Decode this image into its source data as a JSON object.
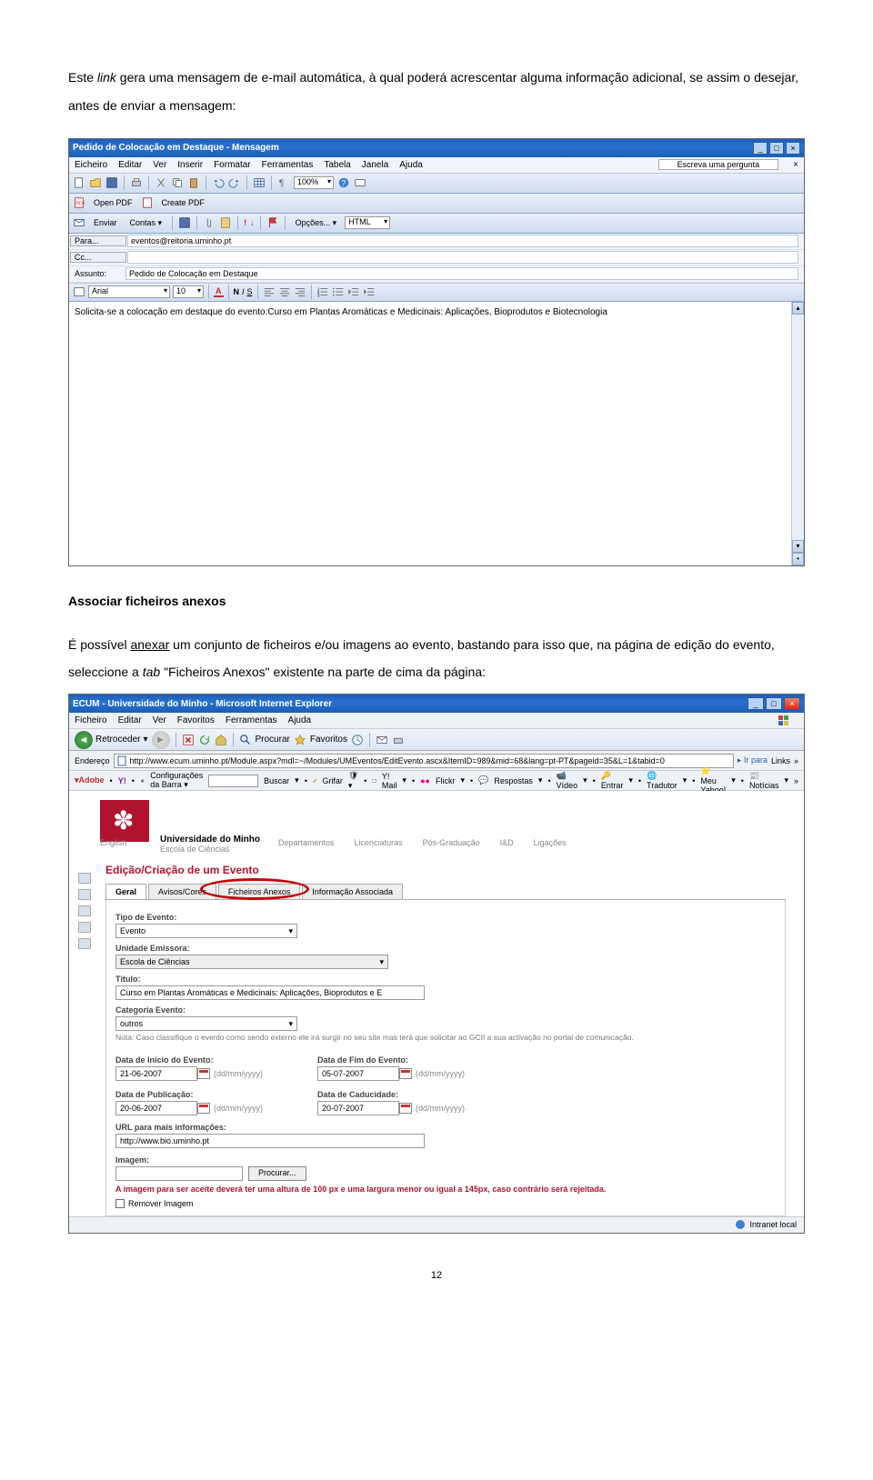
{
  "intro_prefix": "Este ",
  "intro_link": "link",
  "intro_rest": " gera uma mensagem de e-mail automática, à qual poderá acrescentar alguma informação adicional, se assim o desejar, antes de enviar a mensagem:",
  "section_title": "Associar ficheiros anexos",
  "para_prefix": "É possível ",
  "para_anexar": "anexar",
  "para_mid": " um conjunto de ficheiros e/ou imagens ao evento, bastando para isso que, na página de edição do evento, seleccione a ",
  "para_tab": "tab",
  "para_end": " \"Ficheiros Anexos\" existente na parte de cima da página:",
  "page_number": "12",
  "outlook": {
    "title": "Pedido de Colocação em Destaque - Mensagem",
    "menu": [
      "Eicheiro",
      "Editar",
      "Ver",
      "Inserir",
      "Formatar",
      "Ferramentas",
      "Tabela",
      "Janela",
      "Ajuda"
    ],
    "pergunta": "Escreva uma pergunta",
    "pdf1": "Open PDF",
    "pdf2": "Create PDF",
    "enviar": "Enviar",
    "contas": "Contas ▾",
    "opcoes": "Opções... ▾",
    "html": "HTML",
    "zoom": "100%",
    "para_label": "Para...",
    "para_value": "eventos@reitoria.uminho.pt",
    "cc_label": "Cc...",
    "assunto_label": "Assunto:",
    "assunto_value": "Pedido de Colocação em Destaque",
    "font": "Arial",
    "size": "10",
    "body": "Solicita-se a colocação em destaque do evento:Curso em Plantas Aromáticas e Medicinais: Aplicações, Bioprodutos e Biotecnologia"
  },
  "ie": {
    "title": "ECUM - Universidade do Minho - Microsoft Internet Explorer",
    "menu": [
      "Ficheiro",
      "Editar",
      "Ver",
      "Favoritos",
      "Ferramentas",
      "Ajuda"
    ],
    "retroceder": "Retroceder",
    "procurar": "Procurar",
    "favoritos": "Favoritos",
    "endereco_label": "Endereço",
    "endereco_value": "http://www.ecum.uminho.pt/Module.aspx?mdl=~/Modules/UMEventos/EditEvento.ascx&ItemID=989&mid=68&lang=pt-PT&pageid=35&L=1&tabid=0",
    "ir_para": "Ir para",
    "links": "Links",
    "adobe": "Adobe",
    "yahoo": "Y!",
    "config": "Configurações da Barra ▾",
    "buscar": "Buscar",
    "grifar": "Grifar",
    "ymail": "Y! Mail",
    "flickr": "Flickr",
    "respostas": "Respostas",
    "video": "Vídeo",
    "entrar": "Entrar",
    "tradutor": "Tradutor",
    "meuyahoo": "Meu Yahoo!",
    "noticias": "Notícias",
    "english": "English",
    "univ": "Universidade do Minho",
    "escola": "Escola de Ciências",
    "topnav": [
      "Departamentos",
      "Licenciaturas",
      "Pós-Graduação",
      "I&D",
      "Ligações"
    ],
    "page_title": "Edição/Criação de um Evento",
    "tabs": [
      "Geral",
      "Avisos/Cores",
      "Ficheiros Anexos",
      "Informação Associada"
    ],
    "tipo_label": "Tipo de Evento:",
    "tipo_value": "Evento",
    "unidade_label": "Unidade Emissora:",
    "unidade_value": "Escola de Ciências",
    "titulo_label": "Título:",
    "titulo_value": "Curso em Plantas Aromáticas e Medicinais: Aplicações, Bioprodutos e E",
    "cat_label": "Categoria Evento:",
    "cat_value": "outros",
    "nota": "Nota: Caso classifique o evento como sendo externo ele irá surgir no seu site mas terá que solicitar ao GCII a sua activação no portal de comunicação.",
    "data_inicio_label": "Data de Início do Evento:",
    "data_inicio": "21-06-2007",
    "data_fim_label": "Data de Fim do Evento:",
    "data_fim": "05-07-2007",
    "data_pub_label": "Data de Publicação:",
    "data_pub": "20-06-2007",
    "data_cad_label": "Data de Caducidade:",
    "data_cad": "20-07-2007",
    "date_hint": "(dd/mm/yyyy)",
    "url_label": "URL para mais informações:",
    "url_value": "http://www.bio.uminho.pt",
    "imagem_label": "Imagem:",
    "procurar_btn": "Procurar...",
    "img_warn": "A imagem para ser aceite deverá ter uma altura de 100 px e uma largura menor ou igual a 145px, caso contrário será rejeitada.",
    "remover": "Remover Imagem",
    "status_right": "Intranet local"
  }
}
